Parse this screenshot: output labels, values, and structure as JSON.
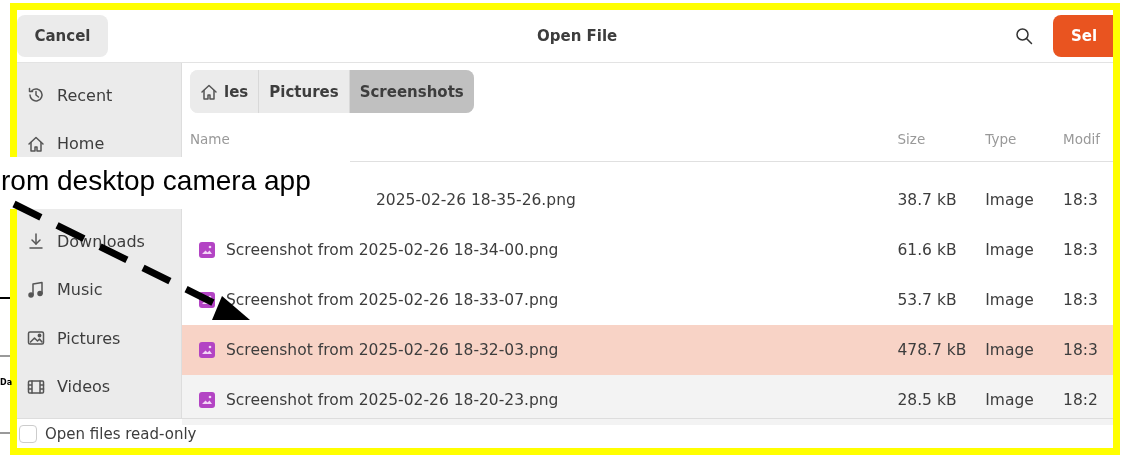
{
  "header": {
    "cancel": "Cancel",
    "title": "Open File",
    "select": "Sel"
  },
  "sidebar": {
    "items": [
      {
        "label": "Recent",
        "kind": "recent"
      },
      {
        "label": "Home",
        "kind": "home"
      },
      {
        "label": "Downloads",
        "kind": "downloads"
      },
      {
        "label": "Music",
        "kind": "music"
      },
      {
        "label": "Pictures",
        "kind": "pictures"
      },
      {
        "label": "Videos",
        "kind": "videos"
      }
    ]
  },
  "breadcrumb": [
    {
      "label": "les",
      "kind": "home",
      "selected": false
    },
    {
      "label": "Pictures",
      "kind": "folder",
      "selected": false
    },
    {
      "label": "Screenshots",
      "kind": "folder",
      "selected": true
    }
  ],
  "table": {
    "columns": [
      "Name",
      "Size",
      "Type",
      "Modif"
    ],
    "rows": [
      {
        "name": "2025-02-26 18-35-26.png",
        "size": "38.7 kB",
        "type": "Image",
        "modified": "18:3",
        "selected": false,
        "hover": false
      },
      {
        "name": "Screenshot from 2025-02-26 18-34-00.png",
        "size": "61.6 kB",
        "type": "Image",
        "modified": "18:3",
        "selected": false,
        "hover": false
      },
      {
        "name": "Screenshot from 2025-02-26 18-33-07.png",
        "size": "53.7 kB",
        "type": "Image",
        "modified": "18:3",
        "selected": false,
        "hover": false
      },
      {
        "name": "Screenshot from 2025-02-26 18-32-03.png",
        "size": "478.7 kB",
        "type": "Image",
        "modified": "18:3",
        "selected": true,
        "hover": false
      },
      {
        "name": "Screenshot from 2025-02-26 18-20-23.png",
        "size": "28.5 kB",
        "type": "Image",
        "modified": "18:2",
        "selected": false,
        "hover": true
      }
    ]
  },
  "read_only": {
    "label": "Open files read-only",
    "checked": false
  },
  "annotation": {
    "text": "rom desktop camera app"
  },
  "background_fragment": "Da"
}
